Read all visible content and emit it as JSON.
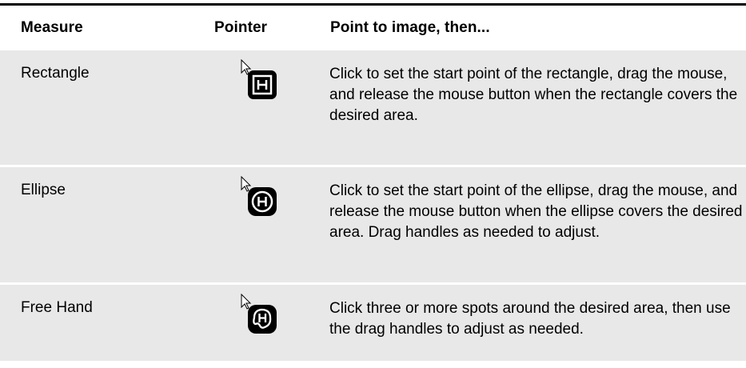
{
  "headers": {
    "measure": "Measure",
    "pointer": "Pointer",
    "point": "Point to image, then..."
  },
  "rows": [
    {
      "measure": "Rectangle",
      "pointer_icon": "rectangle-measure-cursor-icon",
      "description": "Click to set the start point of the rectangle, drag the mouse, and release the mouse button when the rectangle covers the desired area."
    },
    {
      "measure": "Ellipse",
      "pointer_icon": "ellipse-measure-cursor-icon",
      "description": "Click to set the start point of the ellipse, drag the mouse, and release the mouse button when the ellipse covers the desired area. Drag handles as needed to adjust."
    },
    {
      "measure": "Free Hand",
      "pointer_icon": "freehand-measure-cursor-icon",
      "description": "Click three or more spots around the desired area, then use the drag handles to adjust as needed."
    }
  ],
  "colors": {
    "row_background": "#e8e8e8",
    "rule": "#000000",
    "icon_fill": "#000000"
  }
}
